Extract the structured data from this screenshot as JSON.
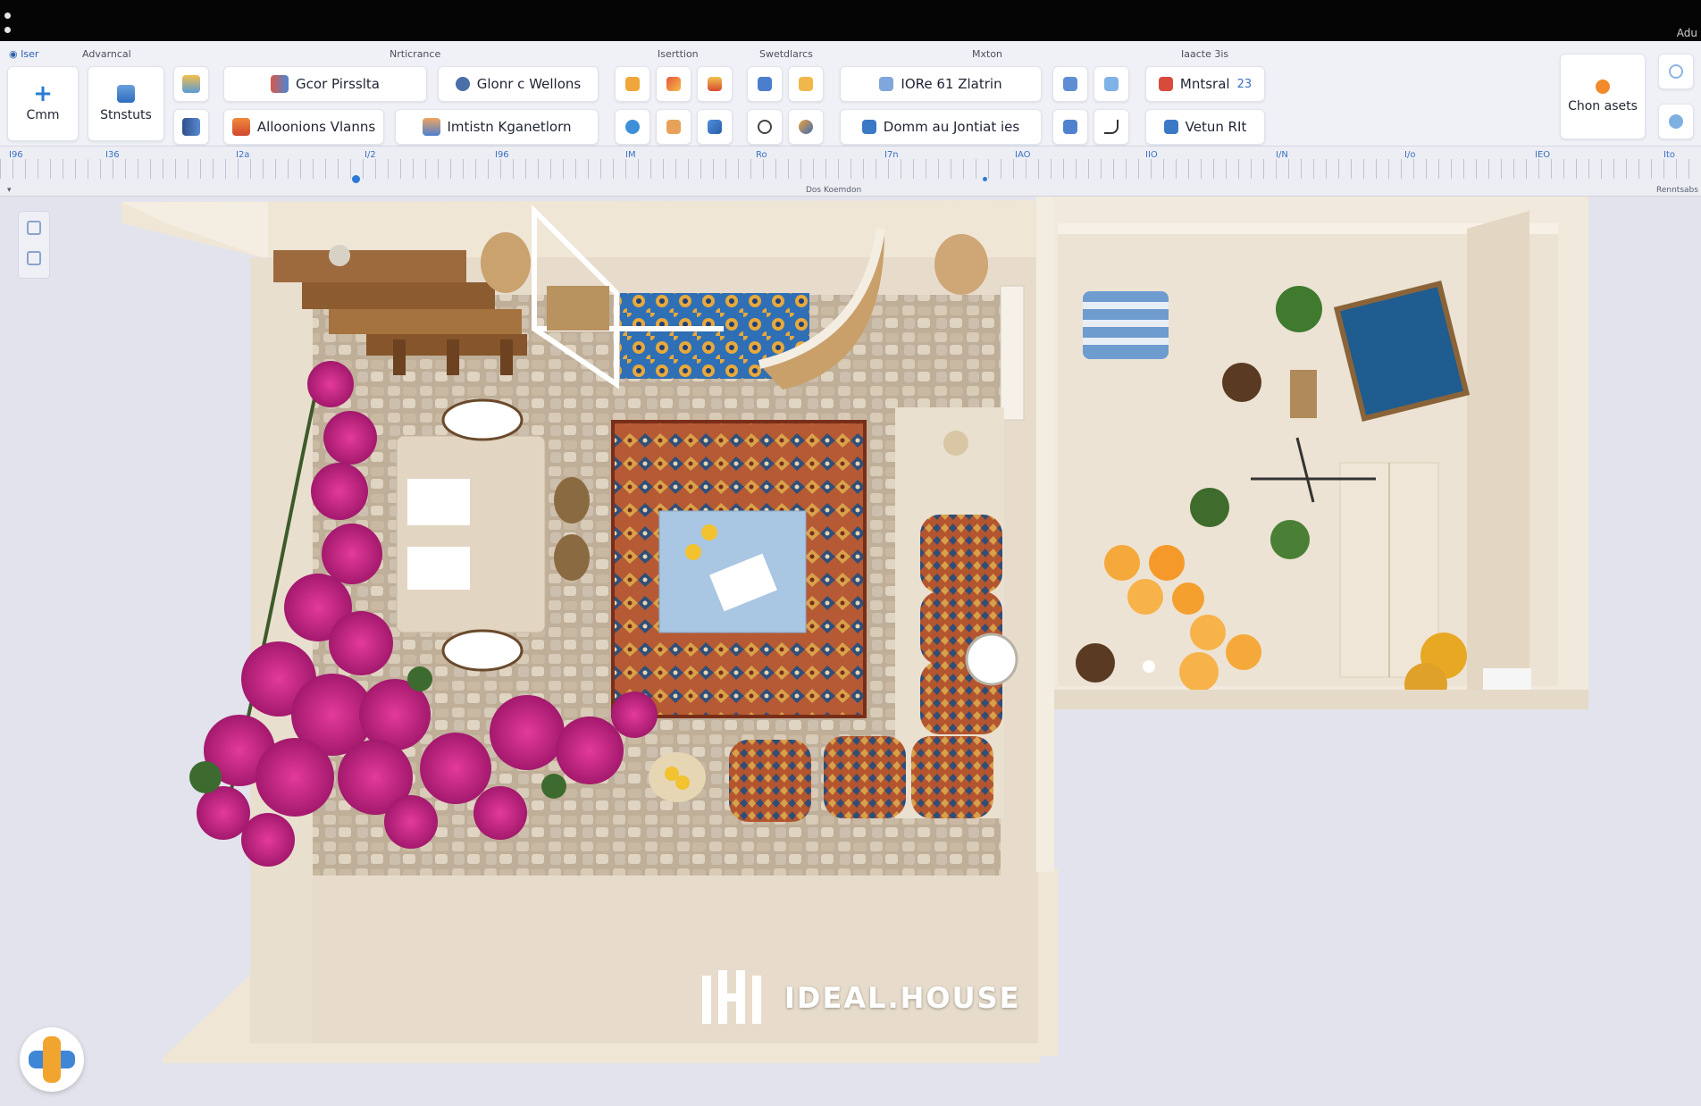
{
  "window": {
    "corner_text": "Adu"
  },
  "ribbon": {
    "app_tab": "Iser",
    "groups": {
      "g1": "Advarncal",
      "g2": "Nrticrance",
      "g3": "Iserttion",
      "g4": "Swetdlarcs",
      "g5": "Mxton",
      "g6": "Iaacte 3is"
    },
    "buttons": {
      "create": "Cmm",
      "structure": "Stnstuts",
      "color_presets": "Gcor Pirsslta",
      "stone_wall": "Glonr c Wellons",
      "addons": "Alloonions Vlanns",
      "interior": "Imtistn Kganetlorn",
      "tile_zone": "IORe 61 Zlatrin",
      "dome": "Domm au Jontiat ies",
      "material": "Mntsral",
      "material_badge": "23",
      "vetum": "Vetun RIt",
      "chart_sheets": "Chon asets"
    }
  },
  "ruler": {
    "numbers": [
      "I96",
      "I36",
      "I2a",
      "I/2",
      "I96",
      "IM",
      "Ro",
      "I7n",
      "IAO",
      "IIO",
      "I/N",
      "I/o",
      "IEO",
      "Ito"
    ],
    "status_center": "Dos Koemdon",
    "status_right": "Renntsabs"
  },
  "watermark": {
    "brand": "IDEAL.HOUSE"
  },
  "colors": {
    "accent": "#2b7ad6",
    "bougainvillea": "#c4217f",
    "walls": "#ece1cf",
    "rug": "#b5542f"
  }
}
